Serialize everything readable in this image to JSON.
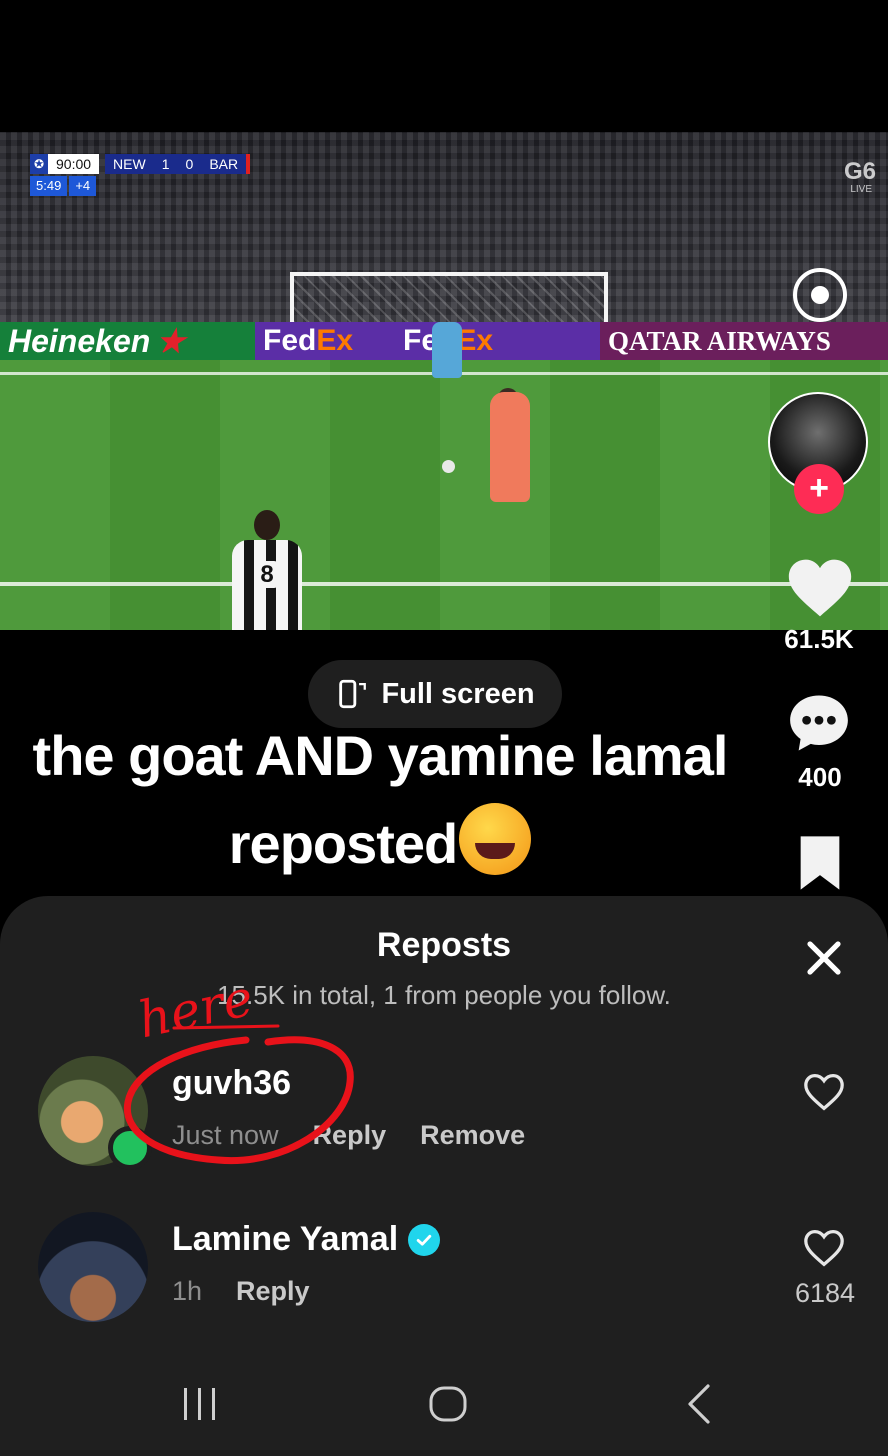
{
  "video": {
    "scorebug": {
      "match_clock": "90:00",
      "elapsed": "5:49",
      "added_time": "+4",
      "home": "NEW",
      "home_score": "1",
      "away_score": "0",
      "away": "BAR"
    },
    "broadcaster": "G6",
    "broadcaster_live": "LIVE",
    "ads": {
      "heineken": "Heineken",
      "fedex_fed": "Fed",
      "fedex_ex": "Ex",
      "fedex_fed_2": "Fed",
      "fedex_ex_2": "Ex",
      "qatar": "QATAR AIRWAYS"
    },
    "player_number": "8"
  },
  "actions": {
    "like_count": "61.5K",
    "comment_count": "400"
  },
  "fullscreen_label": "Full screen",
  "caption": {
    "line1": "the goat AND yamine lamal",
    "line2": "reposted"
  },
  "reposts_sheet": {
    "title": "Reposts",
    "subtitle": "15.5K in total, 1 from people you follow.",
    "items": [
      {
        "name": "guvh36",
        "time": "Just now",
        "reply": "Reply",
        "remove": "Remove"
      },
      {
        "name": "Lamine Yamal",
        "time": "1h",
        "reply": "Reply",
        "likes": "6184"
      }
    ]
  },
  "annotation": {
    "text": "here",
    "color": "#e8121a"
  },
  "colors": {
    "accent_pink": "#fe2c55",
    "verified_cyan": "#20d5ec",
    "online_green": "#22c15e",
    "sheet_bg": "#1f1f1f"
  }
}
